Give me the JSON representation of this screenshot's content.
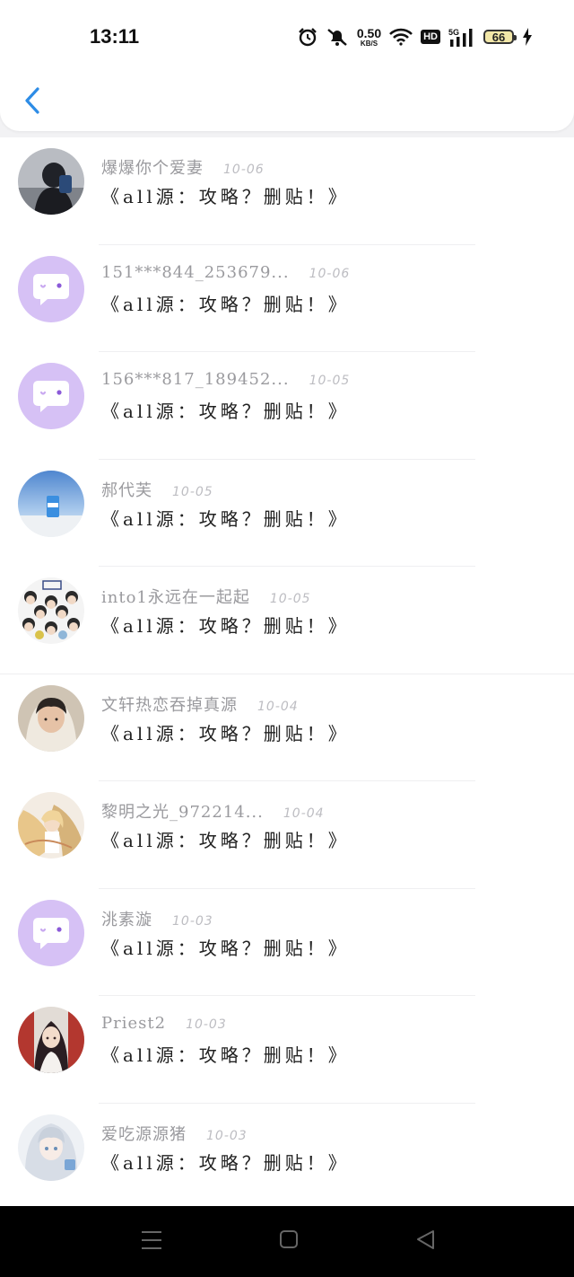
{
  "status_bar": {
    "time": "13:11",
    "net_speed_value": "0.50",
    "net_speed_unit": "KB/S",
    "hd_label": "HD",
    "signal_label": "5G",
    "battery_level": "66",
    "icons": [
      "alarm-icon",
      "mute-bell-icon",
      "wifi-icon",
      "hd-icon",
      "5g-signal-icon",
      "battery-icon",
      "charging-icon"
    ]
  },
  "header": {
    "back_icon": "chevron-left-icon",
    "accent_color": "#2d8ce6"
  },
  "replies": [
    {
      "user": "爆爆你个爱妻",
      "date": "10-06",
      "text": "《all源：攻略？删贴！》",
      "avatar": "photo-dark"
    },
    {
      "user": "151***844_253679...",
      "date": "10-06",
      "text": "《all源：攻略？删贴！》",
      "avatar": "default-chat"
    },
    {
      "user": "156***817_189452...",
      "date": "10-05",
      "text": "《all源：攻略？删贴！》",
      "avatar": "default-chat"
    },
    {
      "user": "郝代芙",
      "date": "10-05",
      "text": "《all源：攻略？删贴！》",
      "avatar": "photo-sky"
    },
    {
      "user": "into1永远在一起起",
      "date": "10-05",
      "text": "《all源：攻略？删贴！》",
      "avatar": "photo-group"
    },
    {
      "user": "文轩热恋吞掉真源",
      "date": "10-04",
      "text": "《all源：攻略？删贴！》",
      "avatar": "photo-person"
    },
    {
      "user": "黎明之光_972214...",
      "date": "10-04",
      "text": "《all源：攻略？删贴！》",
      "avatar": "photo-anime-gold"
    },
    {
      "user": "洮素漩",
      "date": "10-03",
      "text": "《all源：攻略？删贴！》",
      "avatar": "default-chat"
    },
    {
      "user": "Priest2",
      "date": "10-03",
      "text": "《all源：攻略？删贴！》",
      "avatar": "photo-anime-red"
    },
    {
      "user": "爱吃源源猪",
      "date": "10-03",
      "text": "《all源：攻略？删贴！》",
      "avatar": "photo-anime-white"
    }
  ],
  "nav_bar": {
    "icons": [
      "menu-icon",
      "home-square-icon",
      "back-triangle-icon"
    ]
  },
  "colors": {
    "default_avatar_bg": "#d6c1f5",
    "name_text": "#9a9a9e",
    "date_text": "#bdbdc2"
  }
}
